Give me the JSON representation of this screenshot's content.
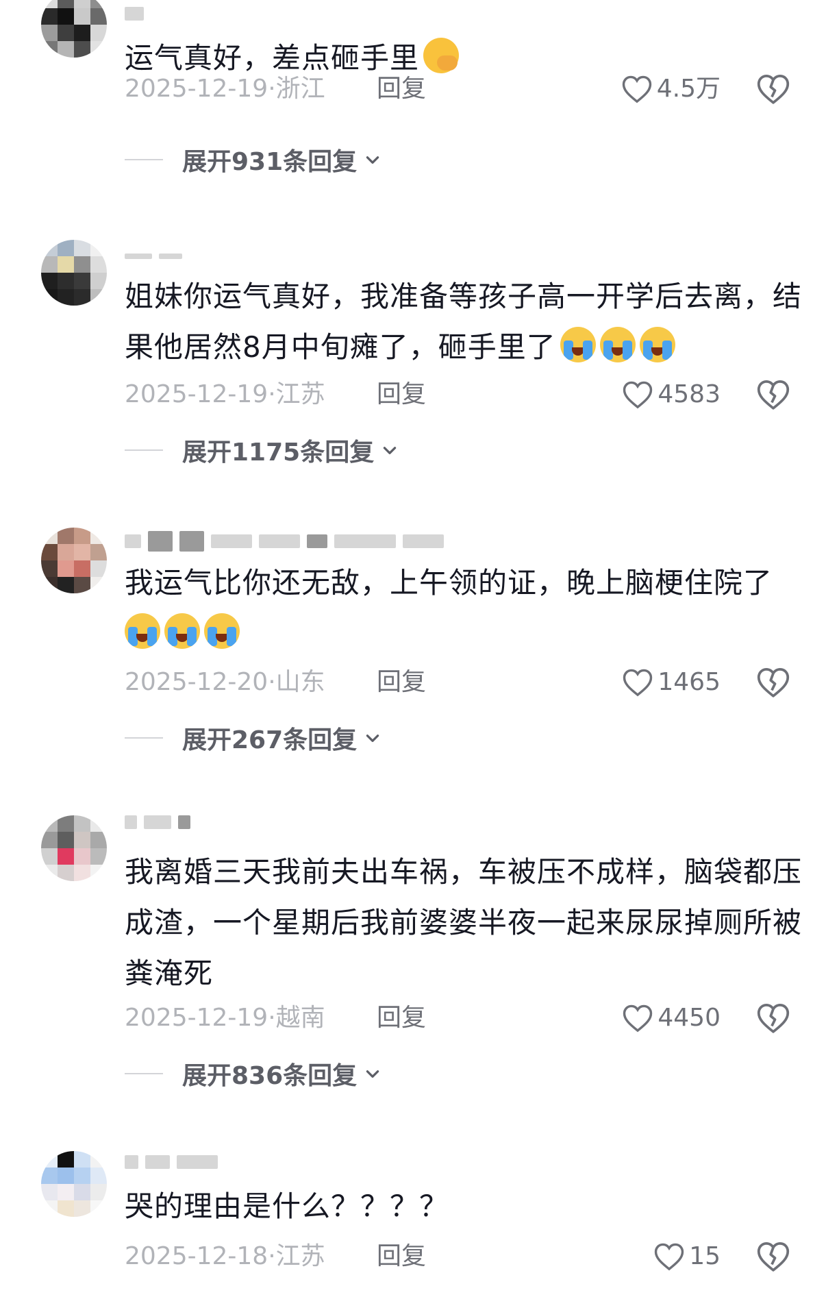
{
  "comments": [
    {
      "text": "运气真好，差点砸手里",
      "emoji": [
        "smirk"
      ],
      "date": "2025-12-19",
      "location": "浙江",
      "reply_label": "回复",
      "likes": "4.5万",
      "expand_label": "展开931条回复"
    },
    {
      "text": "姐妹你运气真好，我准备等孩子高一开学后去离，结果他居然8月中旬瘫了，砸手里了",
      "emoji": [
        "cry",
        "cry",
        "cry"
      ],
      "date": "2025-12-19",
      "location": "江苏",
      "reply_label": "回复",
      "likes": "4583",
      "expand_label": "展开1175条回复"
    },
    {
      "text": "我运气比你还无敌，上午领的证，晚上脑梗住院了",
      "emoji": [
        "cry",
        "cry",
        "cry"
      ],
      "date": "2025-12-20",
      "location": "山东",
      "reply_label": "回复",
      "likes": "1465",
      "expand_label": "展开267条回复"
    },
    {
      "text": "我离婚三天我前夫出车祸，车被压不成样，脑袋都压成渣，一个星期后我前婆婆半夜一起来尿尿掉厕所被粪淹死",
      "emoji": [],
      "date": "2025-12-19",
      "location": "越南",
      "reply_label": "回复",
      "likes": "4450",
      "expand_label": "展开836条回复"
    },
    {
      "text": "哭的理由是什么？？？？",
      "emoji": [],
      "date": "2025-12-18",
      "location": "江苏",
      "reply_label": "回复",
      "likes": "15",
      "expand_label": ""
    }
  ],
  "icons": {
    "like": "heart-outline-icon",
    "dislike": "broken-heart-icon",
    "expand": "chevron-down-icon"
  },
  "colors": {
    "text": "#161823",
    "meta": "#b1b3b8",
    "action": "#6e7077"
  }
}
